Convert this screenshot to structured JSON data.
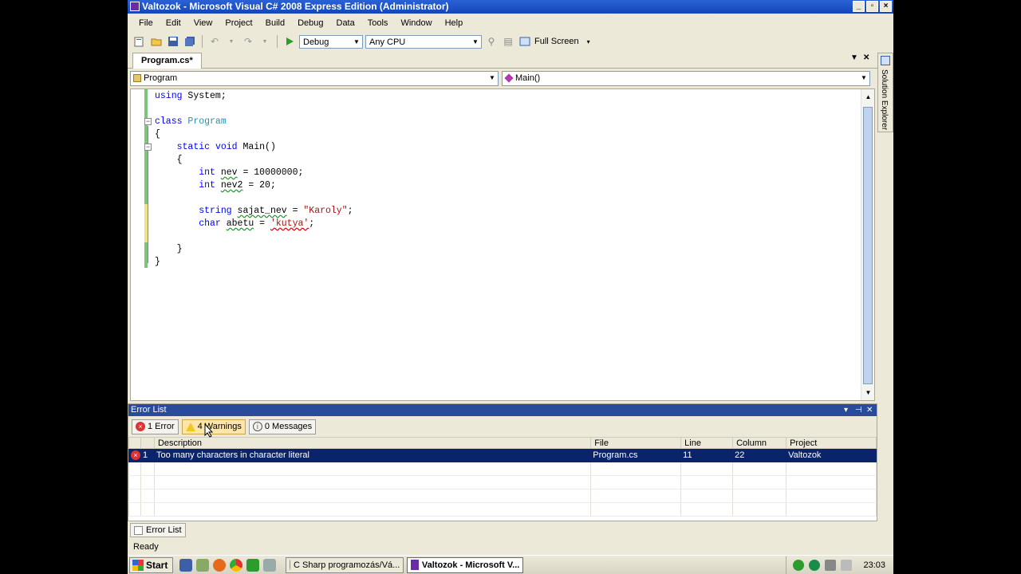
{
  "window": {
    "title": "Valtozok - Microsoft Visual C# 2008 Express Edition (Administrator)",
    "controls": [
      "_",
      "▫",
      "×"
    ]
  },
  "menu": [
    "File",
    "Edit",
    "View",
    "Project",
    "Build",
    "Debug",
    "Data",
    "Tools",
    "Window",
    "Help"
  ],
  "toolbar": {
    "config": "Debug",
    "platform": "Any CPU",
    "fullscreen": "Full Screen"
  },
  "doc_tab": "Program.cs*",
  "right_rail": "Solution Explorer",
  "nav": {
    "type_combo": "Program",
    "member_combo": "Main()"
  },
  "code": {
    "lines": [
      "using System;",
      "",
      "class Program",
      "{",
      "    static void Main()",
      "    {",
      "        int nev = 10000000;",
      "        int nev2 = 20;",
      "",
      "        string sajat_nev = \"Karoly\";",
      "        char abetu = 'kutya';",
      "",
      "    }",
      "}"
    ]
  },
  "error_list": {
    "title": "Error List",
    "filters": {
      "errors": "1 Error",
      "warnings": "4 Warnings",
      "messages": "0 Messages"
    },
    "columns": [
      "",
      "",
      "Description",
      "File",
      "Line",
      "Column",
      "Project"
    ],
    "rows": [
      {
        "num": "1",
        "description": "Too many characters in character literal",
        "file": "Program.cs",
        "line": "11",
        "column": "22",
        "project": "Valtozok"
      }
    ]
  },
  "bottom_tab": "Error List",
  "status": "Ready",
  "taskbar": {
    "start": "Start",
    "tasks": [
      "C Sharp programozás/Vá...",
      "Valtozok - Microsoft V..."
    ],
    "clock": "23:03"
  },
  "colors": {
    "keyword": "#0000ff",
    "type": "#2b91af",
    "string": "#a31515",
    "selection": "#0a246a"
  }
}
